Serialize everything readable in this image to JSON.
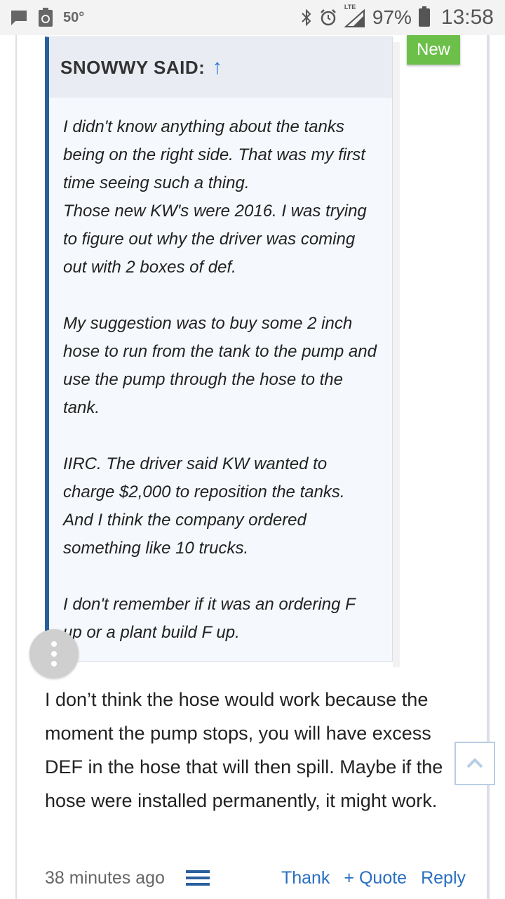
{
  "status_bar": {
    "temperature": "50°",
    "network": "LTE",
    "battery_percent": "97%",
    "time": "13:58",
    "icons": [
      "message-icon",
      "recycle-icon",
      "bluetooth-icon",
      "alarm-icon",
      "signal-icon",
      "battery-icon"
    ]
  },
  "badge": {
    "label": "New",
    "color": "#6cc04a"
  },
  "quote": {
    "author_label": "SNOWWY SAID:",
    "arrow": "↑",
    "paragraphs": [
      "I didn't know anything about the tanks being on the right side. That was my first time seeing such a thing.\nThose new KW's were 2016. I was trying to figure out why the driver was coming out with 2 boxes of def.",
      "My suggestion was to buy some 2 inch hose to run from the tank to the pump and use the pump through the hose to the tank.",
      "IIRC. The driver said KW wanted to charge $2,000 to reposition the tanks. And I think the company ordered something like 10 trucks.",
      "I don't remember if it was an ordering F up or a plant build F up."
    ]
  },
  "post": {
    "text": "I don’t think the hose would work because the moment the pump stops, you will have excess DEF in the hose that will then spill. Maybe if the hose were installed permanently, it might work.",
    "timestamp": "38 minutes ago",
    "actions": {
      "thank": "Thank",
      "quote": "+ Quote",
      "reply": "Reply"
    }
  },
  "colors": {
    "accent": "#2a5f9e",
    "link": "#2a6fc1"
  }
}
